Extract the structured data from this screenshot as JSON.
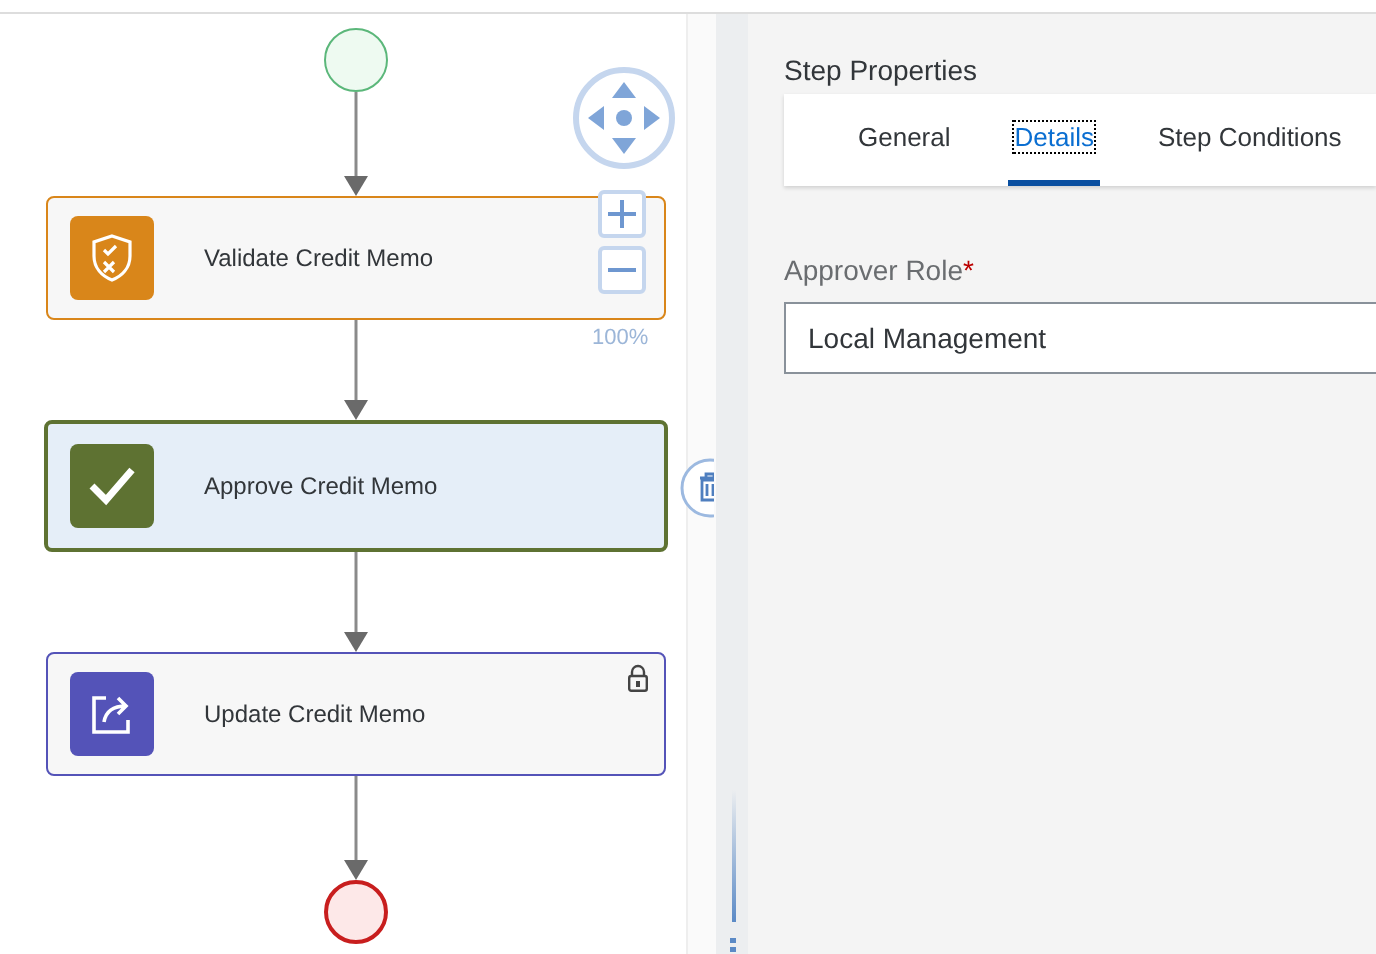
{
  "canvas": {
    "nodes": [
      {
        "kind": "start"
      },
      {
        "kind": "task",
        "label": "Validate Credit Memo",
        "color": "#d9861a",
        "selected": false,
        "locked": false
      },
      {
        "kind": "task",
        "label": "Approve Credit Memo",
        "color": "#5e7232",
        "selected": true,
        "locked": false
      },
      {
        "kind": "task",
        "label": "Update Credit Memo",
        "color": "#5453b8",
        "selected": false,
        "locked": true
      },
      {
        "kind": "end"
      }
    ],
    "zoom": "100%"
  },
  "panel": {
    "title": "Step Properties",
    "tabs": [
      {
        "label": "General",
        "selected": false
      },
      {
        "label": "Details",
        "selected": true
      },
      {
        "label": "Step Conditions",
        "selected": false
      }
    ],
    "field": {
      "label": "Approver Role",
      "required_mark": "*",
      "value": "Local Management"
    }
  }
}
